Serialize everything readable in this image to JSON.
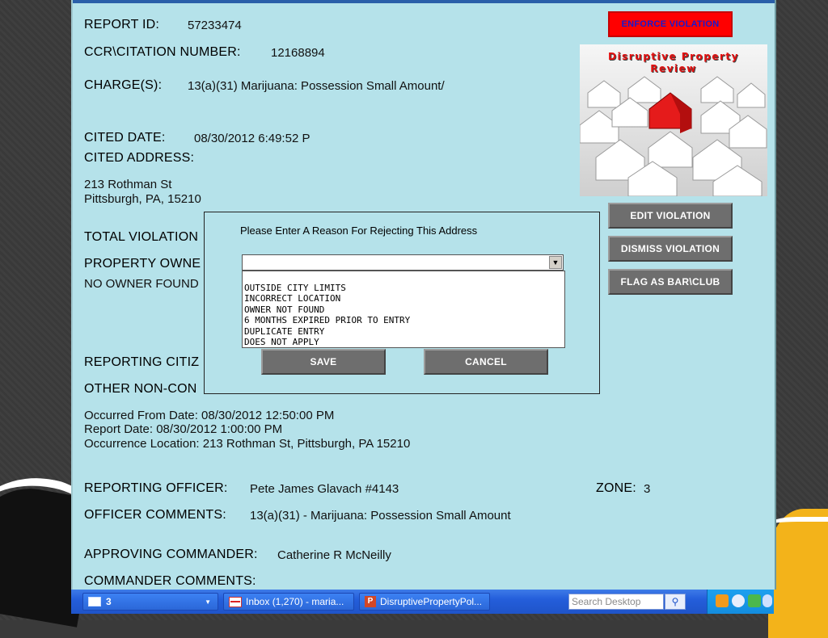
{
  "report": {
    "id_label": "REPORT  ID:",
    "id_value": "57233474",
    "citation_label": "CCR\\CITATION NUMBER:",
    "citation_value": "12168894",
    "charge_label": "CHARGE(S):",
    "charge_value": "13(a)(31) Marijuana: Possession Small Amount/",
    "cited_date_label": "CITED DATE:",
    "cited_date_value": "08/30/2012  6:49:52 P",
    "cited_address_label": "CITED ADDRESS:",
    "address_line1": "213 Rothman St",
    "address_line2": "Pittsburgh, PA, 15210",
    "total_violation_label": "TOTAL VIOLATION",
    "property_owner_label": "PROPERTY OWNE",
    "property_owner_value": "NO OWNER FOUND",
    "reporting_citizen_label": "REPORTING CITIZ",
    "other_non_label": "OTHER NON-CON",
    "occurred_from": "Occurred From Date: 08/30/2012 12:50:00 PM",
    "report_date": "Report Date: 08/30/2012 1:00:00 PM",
    "occurrence_location": "Occurrence Location: 213 Rothman St, Pittsburgh, PA 15210",
    "reporting_officer_label": "REPORTING OFFICER:",
    "reporting_officer_value": "Pete James Glavach  #4143",
    "zone_label": "ZONE:",
    "zone_value": "3",
    "officer_comments_label": "OFFICER COMMENTS:",
    "officer_comments_value": "13(a)(31) - Marijuana: Possession Small Amount",
    "approving_commander_label": "APPROVING COMMANDER:",
    "approving_commander_value": "Catherine R McNeilly",
    "commander_comments_label": "COMMANDER COMMENTS:"
  },
  "actions": {
    "enforce": "ENFORCE VIOLATION",
    "edit": "EDIT VIOLATION",
    "dismiss": "DISMISS VIOLATION",
    "flag": "FLAG AS BAR\\CLUB"
  },
  "thumbnail": {
    "title_line1": "Disruptive Property",
    "title_line2": "Review"
  },
  "modal": {
    "prompt": "Please Enter A Reason For Rejecting This Address",
    "selected_value": "",
    "options": [
      "OUTSIDE CITY LIMITS",
      "INCORRECT LOCATION",
      "OWNER NOT FOUND",
      "6 MONTHS EXPIRED PRIOR TO ENTRY",
      "DUPLICATE ENTRY",
      "DOES NOT APPLY"
    ],
    "save": "SAVE",
    "cancel": "CANCEL"
  },
  "taskbar": {
    "group_count": "3",
    "inbox": "Inbox (1,270) - maria...",
    "ppt": "DisruptivePropertyPol...",
    "search_placeholder": "Search Desktop"
  },
  "colors": {
    "panel": "#b5e2ea",
    "enforce_bg": "#ff0000",
    "enforce_text": "#1a1acd",
    "button_gray": "#6e6e6e",
    "taskbar": "#245edb"
  }
}
